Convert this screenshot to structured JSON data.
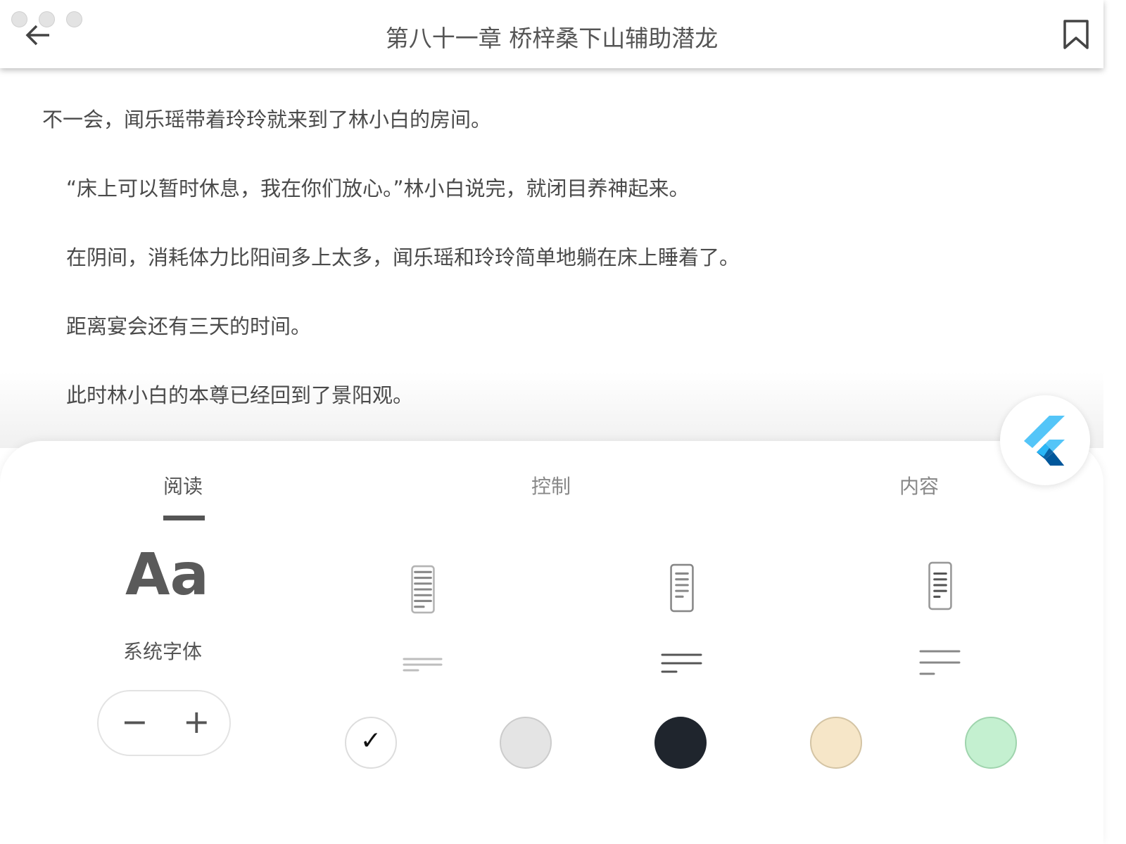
{
  "header": {
    "title": "第八十一章 桥梓桑下山辅助潜龙"
  },
  "content": {
    "paragraphs": [
      "不一会，闻乐瑶带着玲玲就来到了林小白的房间。",
      "“床上可以暂时休息，我在你们放心。”林小白说完，就闭目养神起来。",
      "在阴间，消耗体力比阳间多上太多，闻乐瑶和玲玲简单地躺在床上睡着了。",
      "距离宴会还有三天的时间。",
      "此时林小白的本尊已经回到了景阳观。"
    ]
  },
  "panel": {
    "tabs": [
      {
        "label": "阅读"
      },
      {
        "label": "控制"
      },
      {
        "label": "内容"
      }
    ],
    "font_sample": "Aa",
    "font_name": "系统字体",
    "stepper": {
      "minus": "−",
      "plus": "+"
    },
    "themes": [
      {
        "name": "white",
        "color": "#ffffff",
        "selected": true,
        "check": "✓"
      },
      {
        "name": "gray",
        "color": "#e4e4e4"
      },
      {
        "name": "dark",
        "color": "#1f252d"
      },
      {
        "name": "beige",
        "color": "#f6e6c8"
      },
      {
        "name": "green",
        "color": "#c4f0d0"
      }
    ]
  }
}
